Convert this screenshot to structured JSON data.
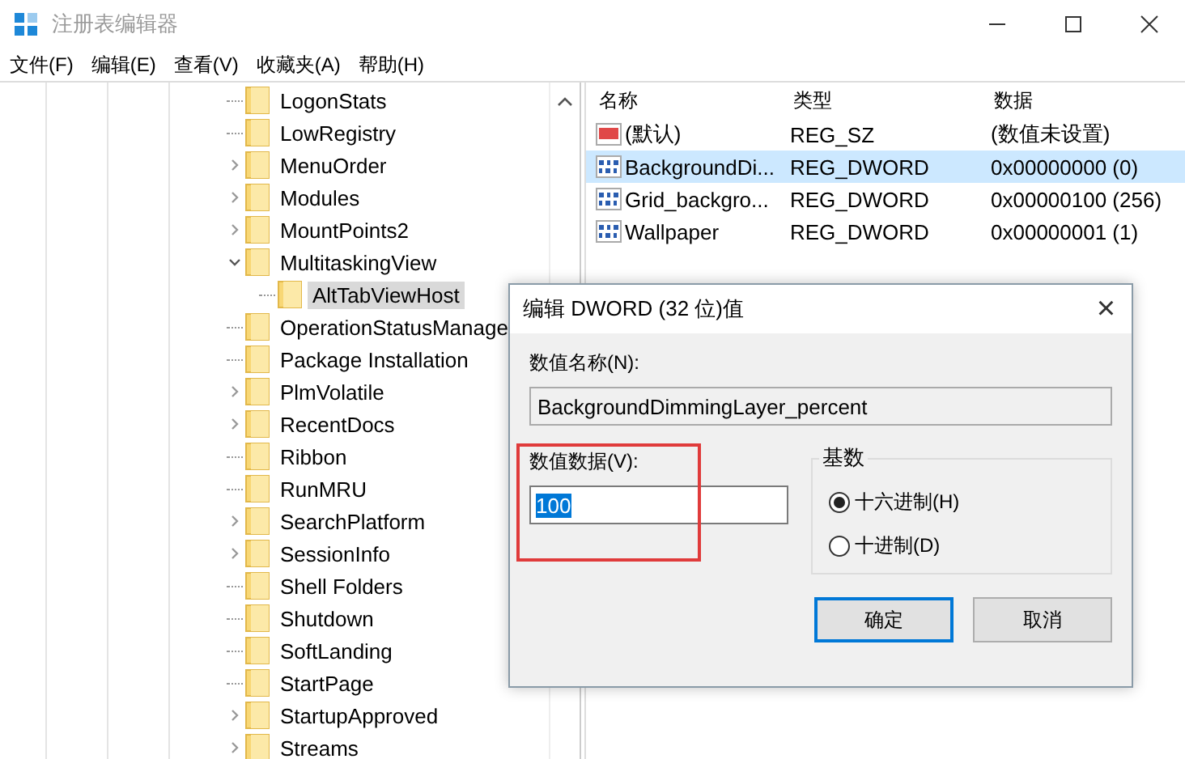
{
  "window": {
    "title": "注册表编辑器"
  },
  "menu": [
    "文件(F)",
    "编辑(E)",
    "查看(V)",
    "收藏夹(A)",
    "帮助(H)"
  ],
  "tree": [
    {
      "label": "LogonStats",
      "expandable": false,
      "selected": false
    },
    {
      "label": "LowRegistry",
      "expandable": false,
      "selected": false
    },
    {
      "label": "MenuOrder",
      "expandable": true,
      "expanded": false,
      "selected": false
    },
    {
      "label": "Modules",
      "expandable": true,
      "expanded": false,
      "selected": false
    },
    {
      "label": "MountPoints2",
      "expandable": true,
      "expanded": false,
      "selected": false
    },
    {
      "label": "MultitaskingView",
      "expandable": true,
      "expanded": true,
      "selected": false,
      "children": [
        {
          "label": "AltTabViewHost",
          "expandable": false,
          "selected": true
        }
      ]
    },
    {
      "label": "OperationStatusManage",
      "expandable": false,
      "selected": false
    },
    {
      "label": "Package Installation",
      "expandable": false,
      "selected": false
    },
    {
      "label": "PlmVolatile",
      "expandable": true,
      "expanded": false,
      "selected": false
    },
    {
      "label": "RecentDocs",
      "expandable": true,
      "expanded": false,
      "selected": false
    },
    {
      "label": "Ribbon",
      "expandable": false,
      "selected": false
    },
    {
      "label": "RunMRU",
      "expandable": false,
      "selected": false
    },
    {
      "label": "SearchPlatform",
      "expandable": true,
      "expanded": false,
      "selected": false
    },
    {
      "label": "SessionInfo",
      "expandable": true,
      "expanded": false,
      "selected": false
    },
    {
      "label": "Shell Folders",
      "expandable": false,
      "selected": false
    },
    {
      "label": "Shutdown",
      "expandable": false,
      "selected": false
    },
    {
      "label": "SoftLanding",
      "expandable": false,
      "selected": false
    },
    {
      "label": "StartPage",
      "expandable": false,
      "selected": false
    },
    {
      "label": "StartupApproved",
      "expandable": true,
      "expanded": false,
      "selected": false
    },
    {
      "label": "Streams",
      "expandable": true,
      "expanded": false,
      "selected": false
    }
  ],
  "values": {
    "columns": [
      "名称",
      "类型",
      "数据"
    ],
    "rows": [
      {
        "kind": "string",
        "name": "(默认)",
        "type": "REG_SZ",
        "data": "(数值未设置)",
        "selected": false
      },
      {
        "kind": "binary",
        "name": "BackgroundDi...",
        "type": "REG_DWORD",
        "data": "0x00000000 (0)",
        "selected": true
      },
      {
        "kind": "binary",
        "name": "Grid_backgro...",
        "type": "REG_DWORD",
        "data": "0x00000100 (256)",
        "selected": false
      },
      {
        "kind": "binary",
        "name": "Wallpaper",
        "type": "REG_DWORD",
        "data": "0x00000001 (1)",
        "selected": false
      }
    ]
  },
  "dialog": {
    "title": "编辑 DWORD (32 位)值",
    "close": "×",
    "name_label": "数值名称(N):",
    "name_value": "BackgroundDimmingLayer_percent",
    "data_label": "数值数据(V):",
    "data_value": "100",
    "base_label": "基数",
    "bases": [
      {
        "label": "十六进制(H)",
        "selected": true
      },
      {
        "label": "十进制(D)",
        "selected": false
      }
    ],
    "buttons": [
      {
        "label": "确定",
        "default": true
      },
      {
        "label": "取消",
        "default": false
      }
    ]
  }
}
